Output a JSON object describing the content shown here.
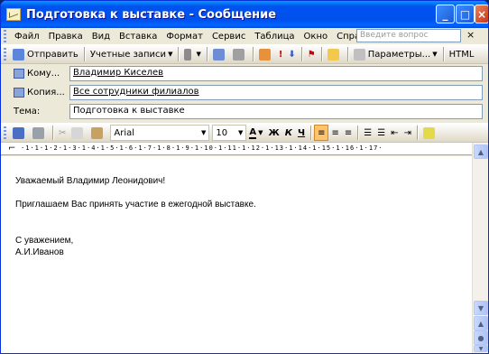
{
  "window": {
    "title": "Подготовка к выставке - Сообщение"
  },
  "menu": {
    "items": [
      "Файл",
      "Правка",
      "Вид",
      "Вставка",
      "Формат",
      "Сервис",
      "Таблица",
      "Окно",
      "Справка"
    ],
    "help_placeholder": "Введите вопрос",
    "close": "×"
  },
  "toolbar1": {
    "send": "Отправить",
    "accounts": "Учетные записи",
    "options": "Параметры...",
    "format": "HTML"
  },
  "header": {
    "to_label": "Кому...",
    "to_value": "Владимир Киселев",
    "cc_label": "Копия...",
    "cc_value": "Все сотрудники филиалов",
    "subject_label": "Тема:",
    "subject_value": "Подготовка к выставке"
  },
  "toolbar2": {
    "font": "Arial",
    "size": "10",
    "bold": "Ж",
    "italic": "К",
    "underline": "Ч"
  },
  "ruler": {
    "scale": "·1·1·1·2·1·3·1·4·1·5·1·6·1·7·1·8·1·9·1·10·1·11·1·12·1·13·1·14·1·15·1·16·1·17·"
  },
  "document": {
    "greeting": "Уважаемый Владимир Леонидович!",
    "body": "Приглашаем Вас принять участие в ежегодной выставке.",
    "closing": "С уважением,",
    "signature": "А.И.Иванов"
  }
}
